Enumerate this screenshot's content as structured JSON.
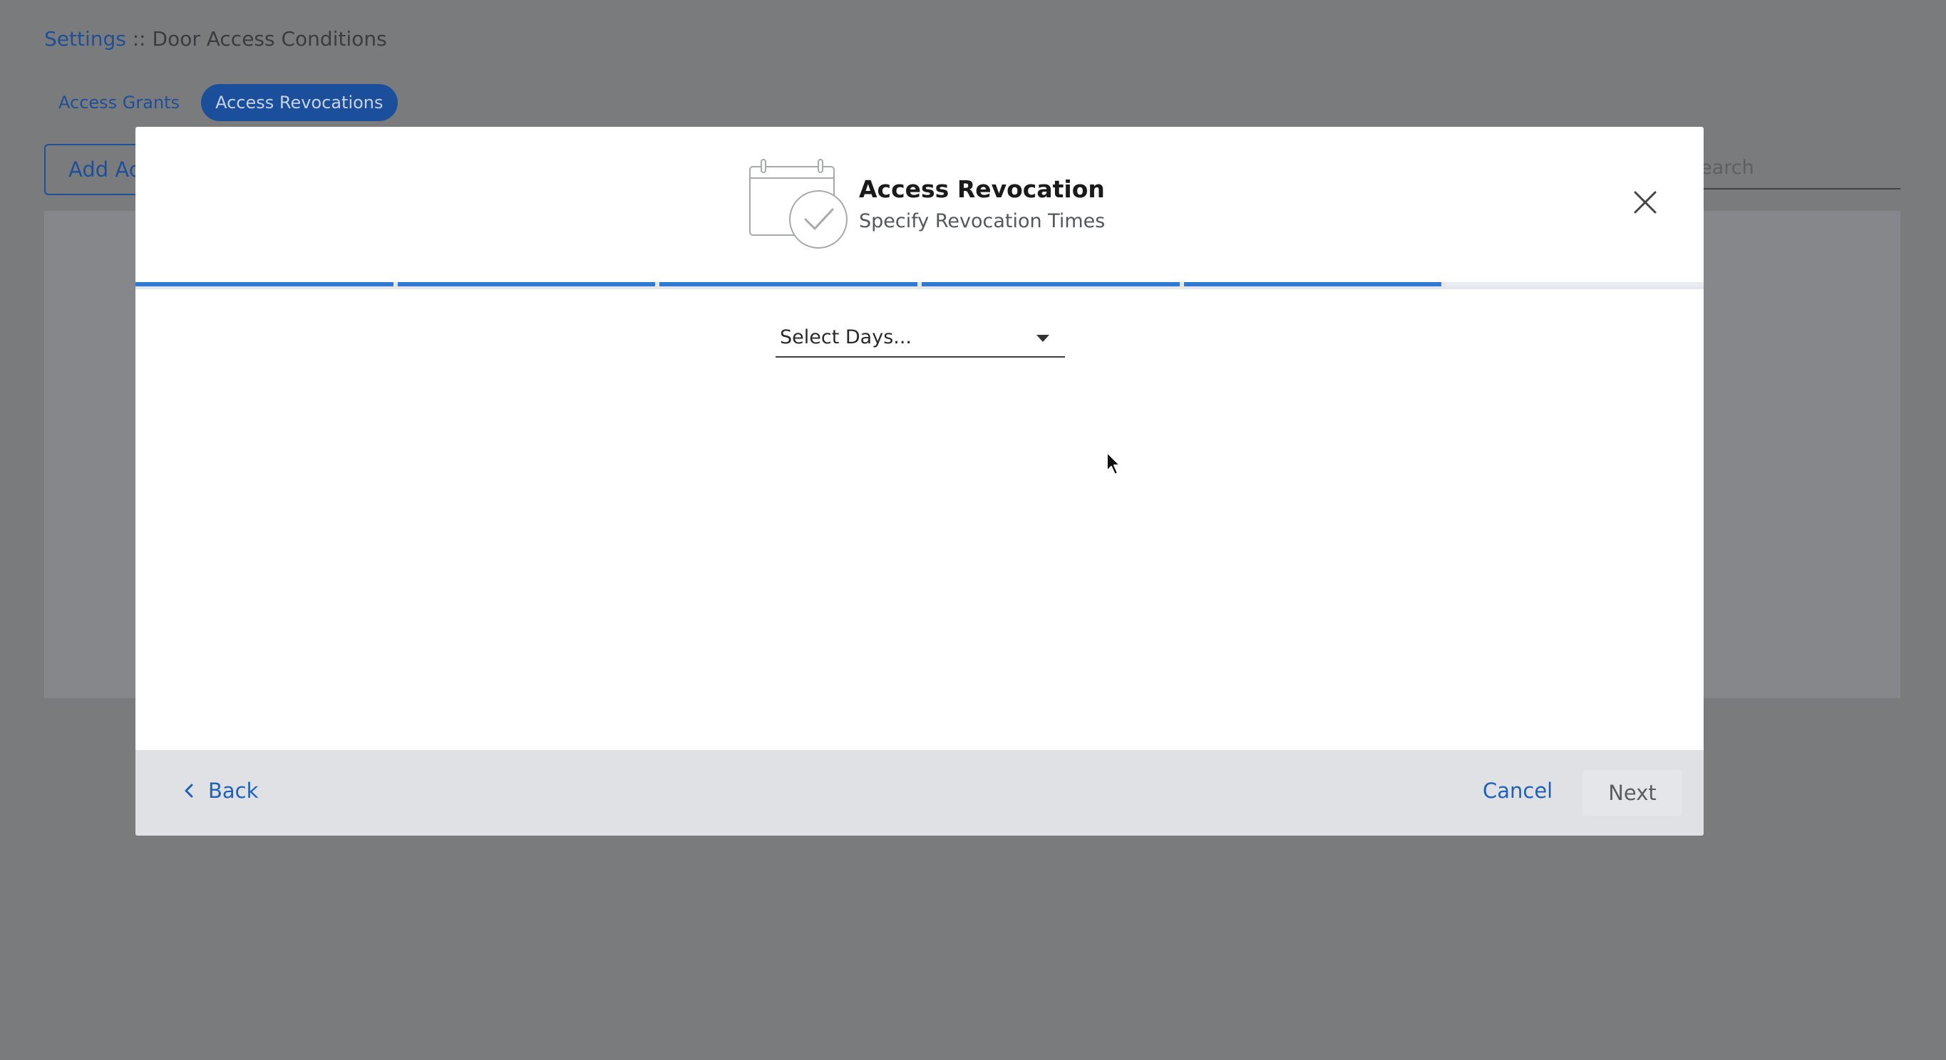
{
  "breadcrumb": {
    "parent": "Settings",
    "separator": " :: ",
    "current": "Door Access Conditions"
  },
  "tabs": [
    {
      "label": "Access Grants",
      "active": false
    },
    {
      "label": "Access Revocations",
      "active": true
    }
  ],
  "toolbar": {
    "add_label": "Add Access Revocation",
    "search_placeholder": "Search"
  },
  "modal": {
    "icon": "calendar-check-icon",
    "title": "Access Revocation",
    "subtitle": "Specify Revocation Times",
    "close_icon": "close-icon",
    "progress": {
      "total_steps": 6,
      "completed_steps": 5
    },
    "days_select": {
      "placeholder": "Select Days...",
      "icon": "caret-down-icon"
    },
    "footer": {
      "back_label": "Back",
      "back_icon": "chevron-left-icon",
      "cancel_label": "Cancel",
      "next_label": "Next"
    }
  },
  "colors": {
    "accent": "#2f78d4",
    "link": "#1f60b8",
    "overlay": "#7a7b7d",
    "footer_bg": "#dfe1e5"
  }
}
